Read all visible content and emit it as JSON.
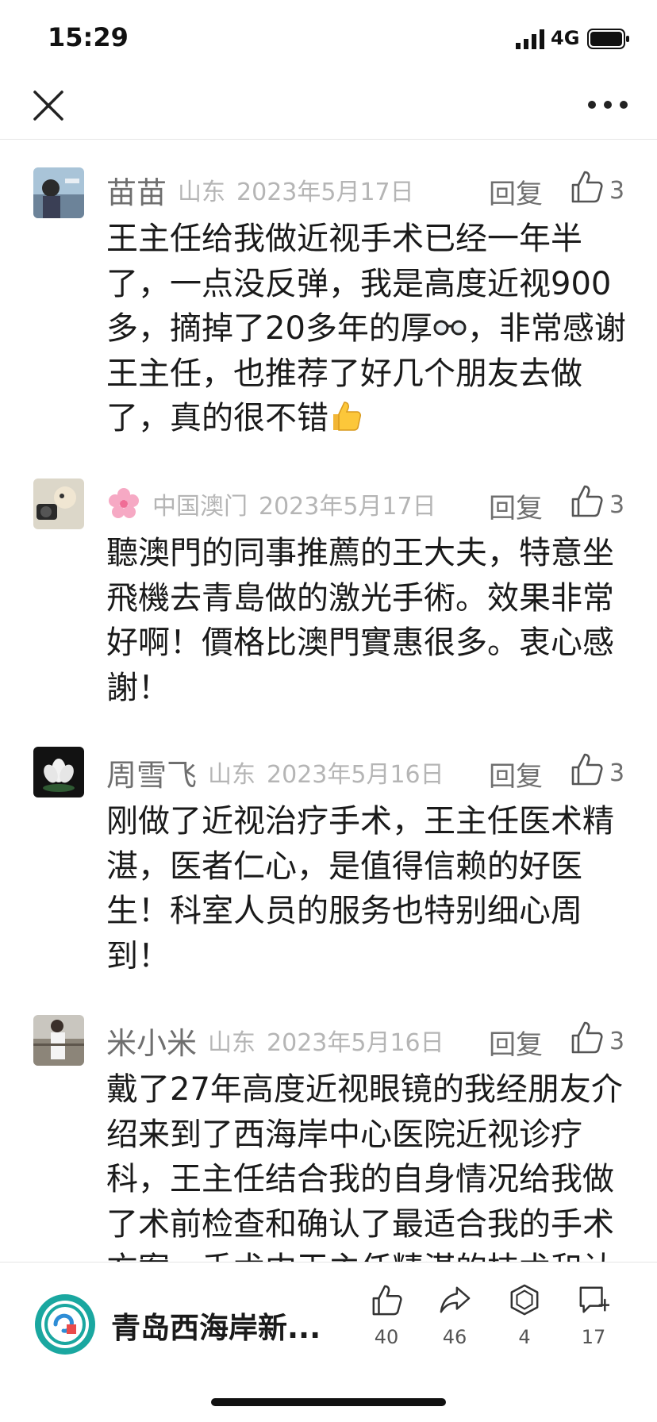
{
  "status": {
    "time": "15:29",
    "network": "4G"
  },
  "icons": {
    "close": "close-icon",
    "more": "more-dots-icon",
    "like": "thumbs-up-icon",
    "share": "share-arrow-icon",
    "favorite": "favorite-hexagon-icon",
    "comment": "comment-plus-icon"
  },
  "comments": [
    {
      "user": "苗苗",
      "region": "山东",
      "date": "2023年5月17日",
      "reply": "回复",
      "likes": "3",
      "text_main": "王主任给我做近视手术已经一年半了，一点没反弹，我是高度近视900多，摘掉了20多年的厚",
      "text_after": "，非常感谢王主任，也推荐了好几个朋友去做了，真的很不错",
      "emojis": [
        "glasses-emoji",
        "thumbs-up-emoji"
      ]
    },
    {
      "user": "",
      "user_icon": "cherry-blossom-icon",
      "region": "中国澳门",
      "date": "2023年5月17日",
      "reply": "回复",
      "likes": "3",
      "text": "聽澳門的同事推薦的王大夫，特意坐飛機去青島做的激光手術。效果非常好啊！價格比澳門實惠很多。衷心感謝！"
    },
    {
      "user": "周雪飞",
      "region": "山东",
      "date": "2023年5月16日",
      "reply": "回复",
      "likes": "3",
      "text": "刚做了近视治疗手术，王主任医术精湛，医者仁心，是值得信赖的好医生！科室人员的服务也特别细心周到！"
    },
    {
      "user": "米小米",
      "region": "山东",
      "date": "2023年5月16日",
      "reply": "回复",
      "likes": "3",
      "text": "戴了27年高度近视眼镜的我经朋友介绍来到了西海岸中心医院近视诊疗科，王主任结合我的自身情况给我做了术前检查和确认了最适合我的手术方案，手术中王主任精湛的技术和认"
    }
  ],
  "bottom_bar": {
    "account_name": "青岛西海岸新...",
    "like_count": "40",
    "share_count": "46",
    "favorite_count": "4",
    "comment_count": "17"
  },
  "colors": {
    "text_primary": "#1a1a1a",
    "text_secondary": "#6f6f6f",
    "text_meta": "#b5b5b5",
    "logo_teal": "#1aa7a0"
  }
}
